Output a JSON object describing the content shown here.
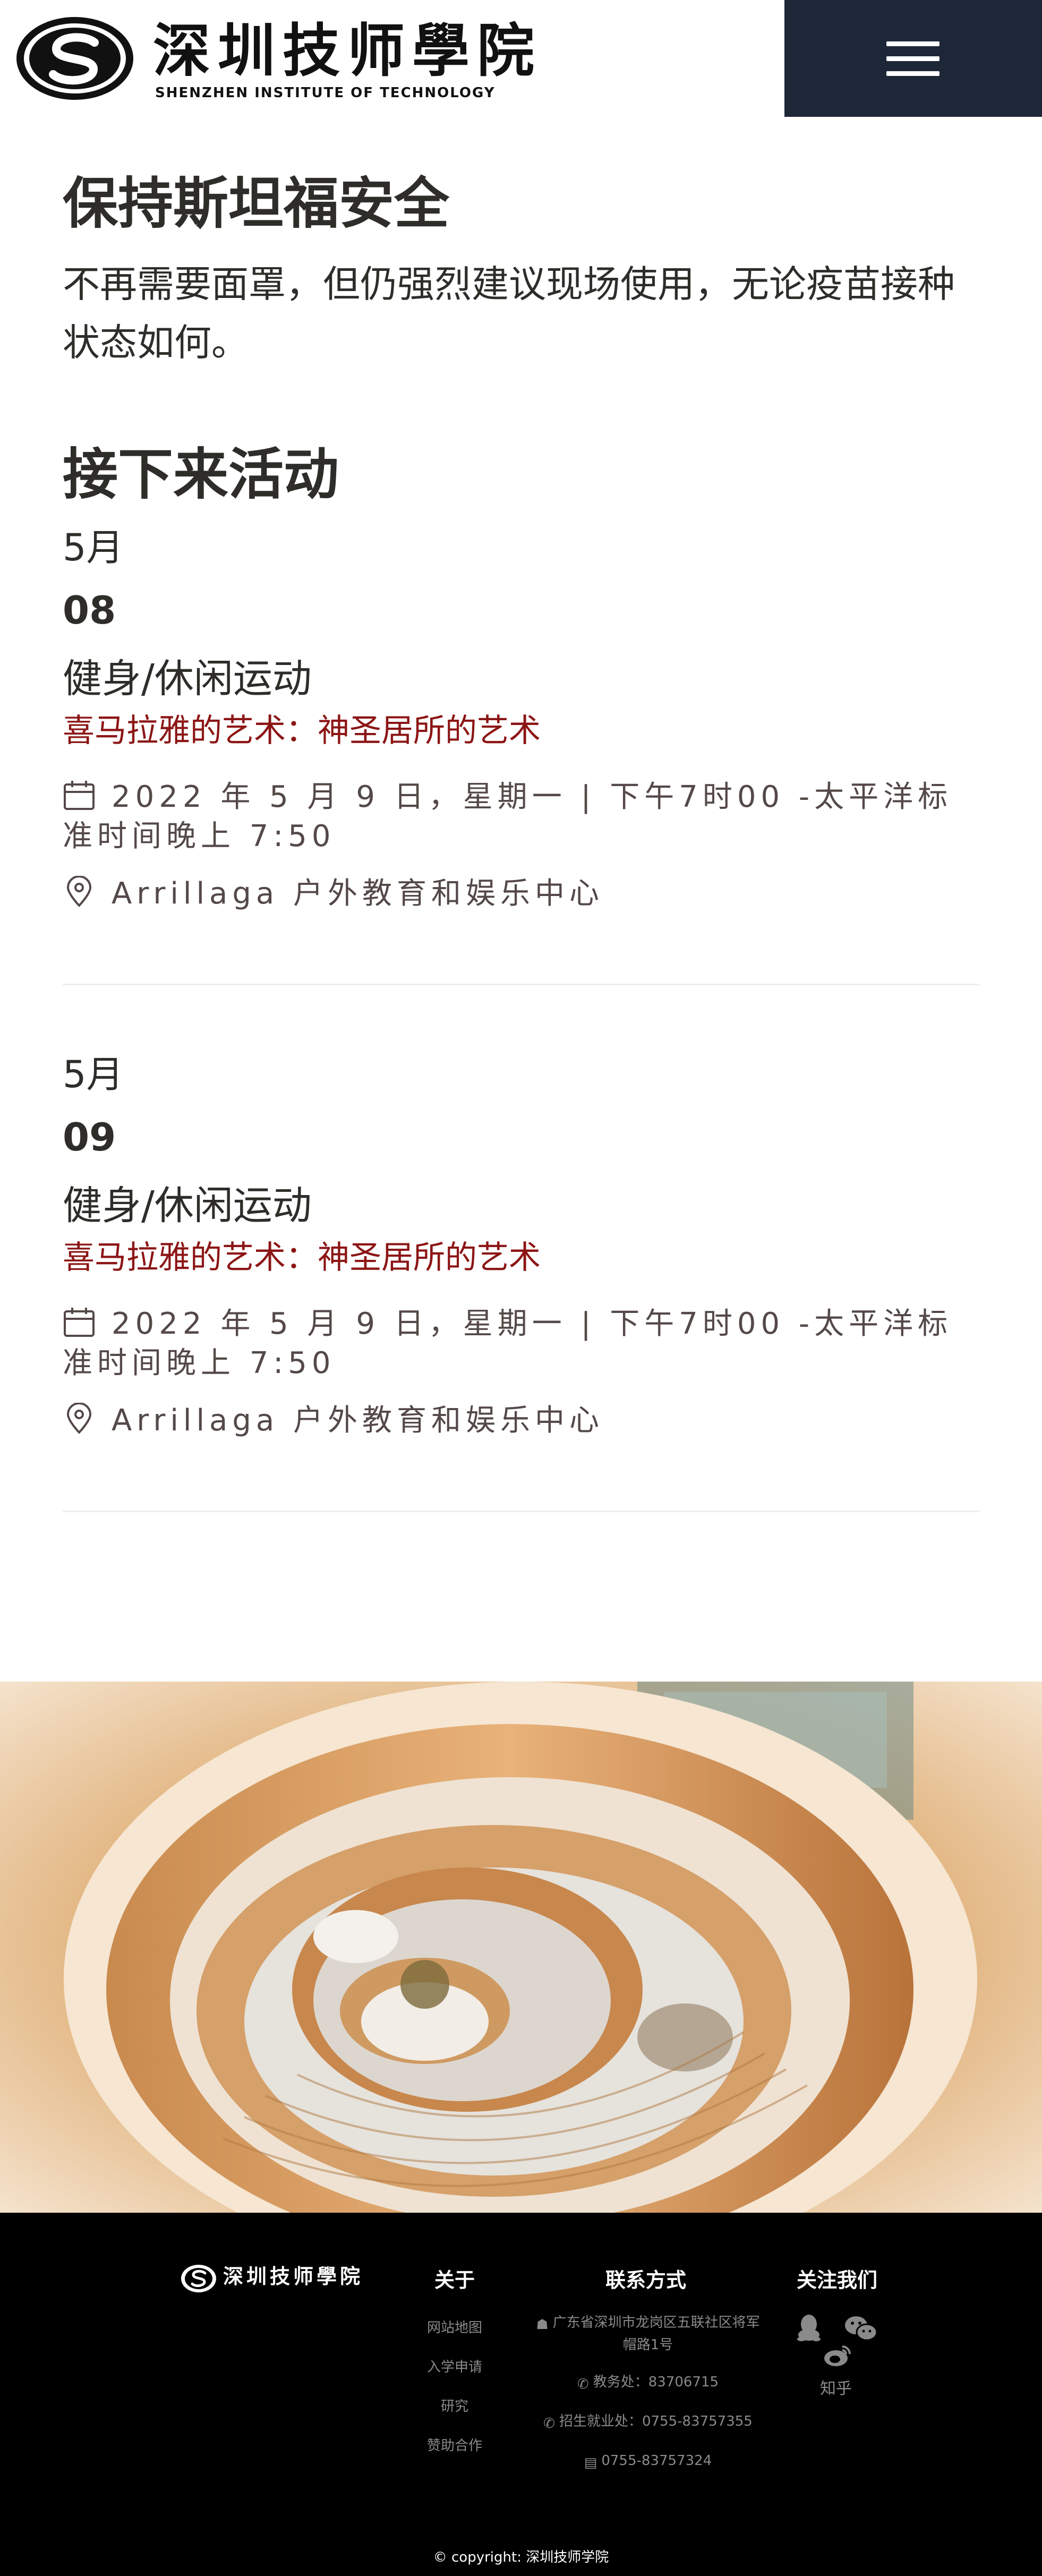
{
  "header": {
    "logo_cn": "深圳技师學院",
    "logo_en": "SHENZHEN INSTITUTE OF TECHNOLOGY",
    "menu_icon": "hamburger-menu-icon"
  },
  "safety": {
    "title": "保持斯坦福安全",
    "body": "不再需要面罩，但仍强烈建议现场使用，无论疫苗接种状态如何。"
  },
  "events": {
    "title": "接下来活动",
    "items": [
      {
        "month": "5月",
        "day": "08",
        "category": "健身/休闲运动",
        "title": "喜马拉雅的艺术：神圣居所的艺术",
        "datetime": "2022 年 5 月 9 日，星期一 | 下午7时00 -太平洋标准时间晚上 7:50",
        "location": "Arrillaga 户外教育和娱乐中心"
      },
      {
        "month": "5月",
        "day": "09",
        "category": "健身/休闲运动",
        "title": "喜马拉雅的艺术：神圣居所的艺术",
        "datetime": "2022 年 5 月 9 日，星期一 | 下午7时00 -太平洋标准时间晚上 7:50",
        "location": "Arrillaga 户外教育和娱乐中心"
      }
    ]
  },
  "footer": {
    "logo_cn": "深圳技师學院",
    "about": {
      "title": "关于",
      "links": [
        "网站地图",
        "入学申请",
        "研究",
        "赞助合作"
      ]
    },
    "contact": {
      "title": "联系方式",
      "address": "广东省深圳市龙岗区五联社区将军帽路1号",
      "office": "教务处：83706715",
      "admission": "招生就业处：0755-83757355",
      "fax": "0755-83757324"
    },
    "follow": {
      "title": "关注我们",
      "zhihu": "知乎",
      "icons": [
        "qq-icon",
        "wechat-icon",
        "weibo-icon"
      ]
    },
    "copyright": "© copyright: 深圳技师学院"
  },
  "colors": {
    "accent_red": "#8c1515",
    "header_dark": "#1e2738",
    "footer_bg": "#000000"
  }
}
